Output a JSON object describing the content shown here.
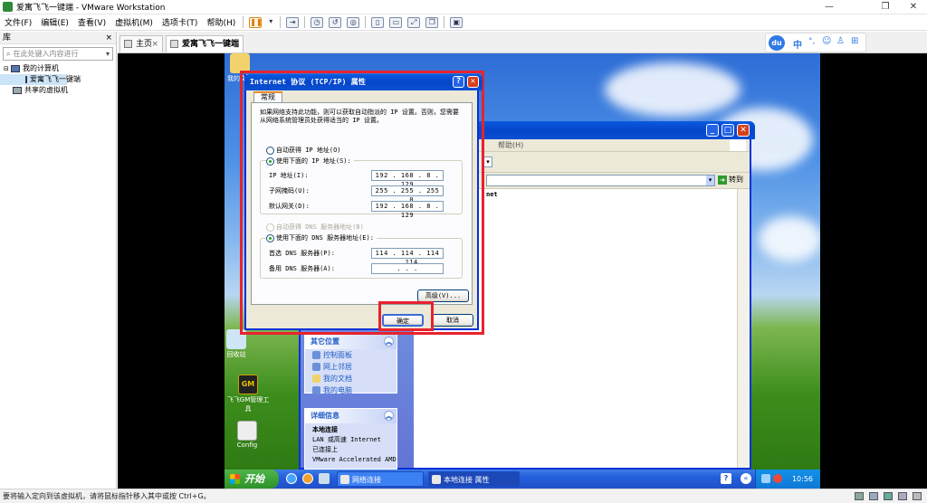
{
  "window": {
    "title": "爱寓飞飞一键端 - VMware Workstation",
    "minimize": "—",
    "maximize": "❐",
    "close": "✕"
  },
  "menubar": {
    "items": [
      "文件(F)",
      "编辑(E)",
      "查看(V)",
      "虚拟机(M)",
      "选项卡(T)",
      "帮助(H)"
    ]
  },
  "library": {
    "title": "库",
    "close": "×",
    "search_placeholder": "在此处键入内容进行",
    "tree": {
      "root": "我的计算机",
      "vm": "爱寓飞飞一键端",
      "shared": "共享的虚拟机"
    }
  },
  "tabs": [
    {
      "label": "主页"
    },
    {
      "label": "爱寓飞飞一键端"
    }
  ],
  "baidu_bar": {
    "logo": "du",
    "items": [
      "中",
      "°,",
      "☺",
      "♙",
      "⊞"
    ]
  },
  "desktop_icons": [
    {
      "label": "我的文档"
    },
    {
      "label": "回收站"
    },
    {
      "label": "飞飞GM管理工具"
    },
    {
      "label": "Config"
    }
  ],
  "bg_window": {
    "menu_help": "帮助(H)",
    "addr_value": "net",
    "go_label": "转到",
    "other_places": {
      "title": "其它位置",
      "links": [
        "控制面板",
        "网上邻居",
        "我的文档",
        "我的电脑"
      ]
    },
    "details": {
      "title": "详细信息",
      "lines": [
        "本地连接",
        "LAN 或高速 Internet",
        "已连接上",
        "VMware Accelerated AMD"
      ]
    }
  },
  "dialog": {
    "title": "Internet 协议 (TCP/IP) 属性",
    "help_btn": "?",
    "close_btn": "✕",
    "tab": "常规",
    "description": "如果网络支持此功能，则可以获取自动指派的 IP 设置。否则，您需要从网络系统管理员处获得适当的 IP 设置。",
    "auto_ip": "自动获得 IP 地址(O)",
    "use_ip": "使用下面的 IP 地址(S):",
    "ip_label": "IP 地址(I):",
    "ip_value": "192 . 168 .  8  . 129",
    "mask_label": "子网掩码(U):",
    "mask_value": "255 . 255 . 255 .  0",
    "gw_label": "默认网关(D):",
    "gw_value": "192 . 168 .  8  . 129",
    "auto_dns": "自动获得 DNS 服务器地址(B)",
    "use_dns": "使用下面的 DNS 服务器地址(E):",
    "pref_dns_label": "首选 DNS 服务器(P):",
    "pref_dns_value": "114 . 114 . 114 . 114",
    "alt_dns_label": "备用 DNS 服务器(A):",
    "alt_dns_value": ".     .     .",
    "advanced": "高级(V)...",
    "ok": "确定",
    "cancel": "取消"
  },
  "taskbar": {
    "start": "开始",
    "tasks": [
      "网络连接",
      "本地连接 属性"
    ],
    "clock": "10:56"
  },
  "statusbar": {
    "text": "要将输入定向到该虚拟机，请将鼠标指针移入其中或按 Ctrl+G。"
  }
}
